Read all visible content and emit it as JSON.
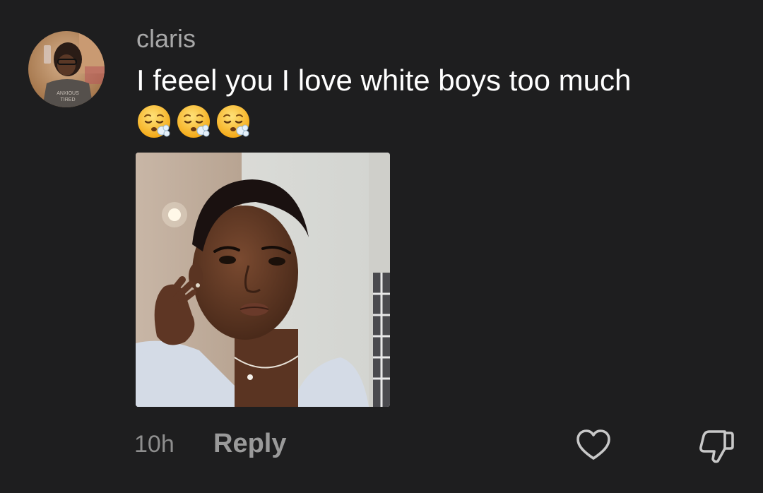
{
  "comment": {
    "username": "claris",
    "text": "I feeel you I love white boys too much",
    "emojis": [
      {
        "icon": "face-exhaling-emoji"
      },
      {
        "icon": "face-exhaling-emoji"
      },
      {
        "icon": "face-exhaling-emoji"
      }
    ],
    "attachment": {
      "icon": "selfie-photo"
    },
    "timestamp": "10h",
    "reply_label": "Reply",
    "like_icon": "heart-outline-icon",
    "dislike_icon": "thumbs-down-outline-icon"
  },
  "colors": {
    "background": "#1e1e1f",
    "username": "#a8a8a8",
    "text": "#ffffff",
    "meta": "#8e8e8e",
    "action_icon": "#c8c8c8"
  }
}
